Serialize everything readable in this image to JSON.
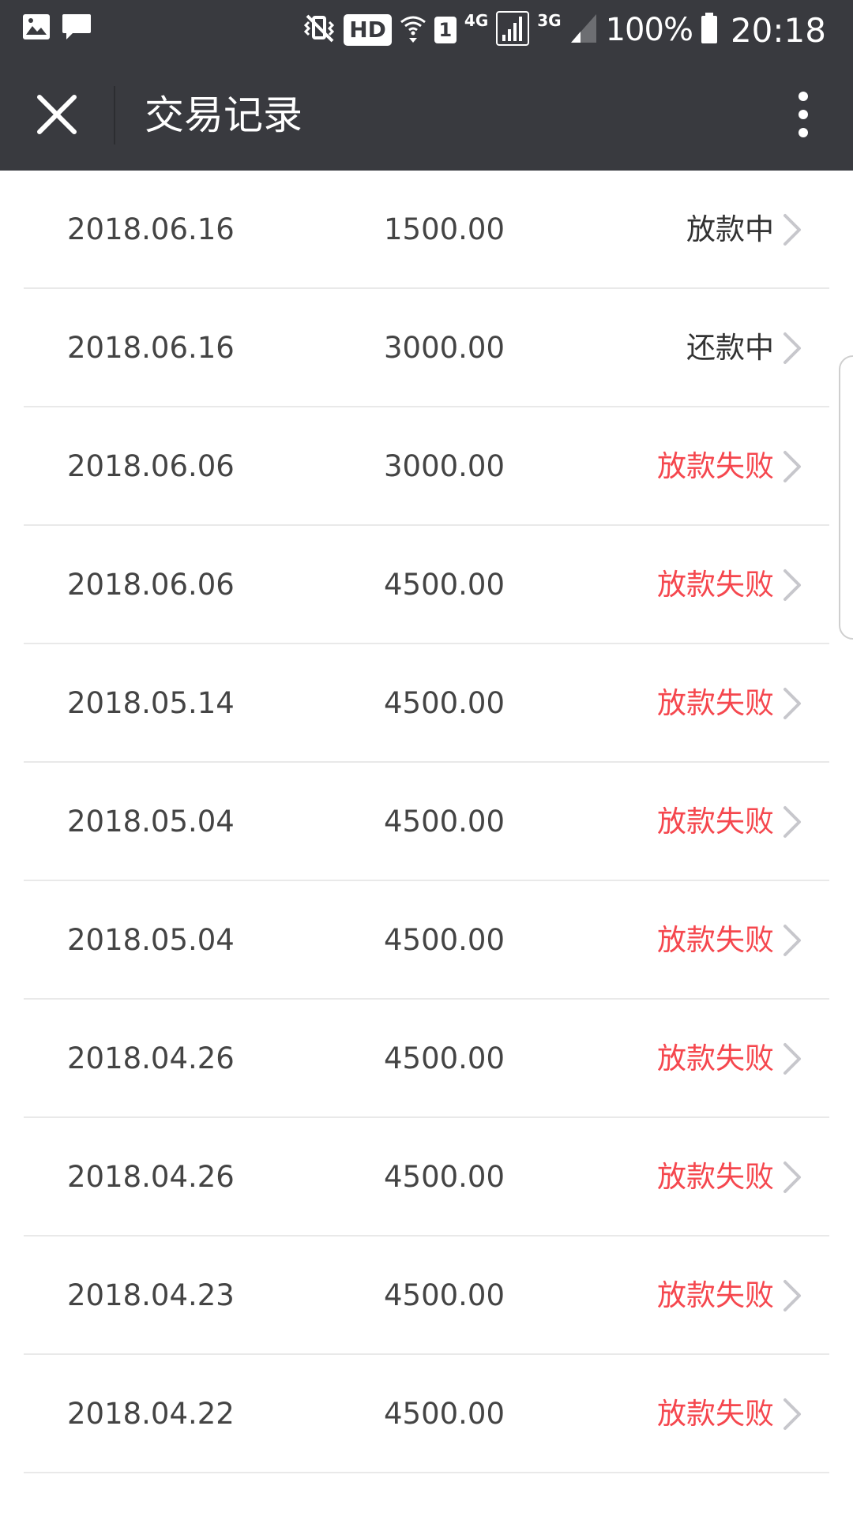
{
  "status_bar": {
    "left_icons": [
      "gallery-icon",
      "message-icon"
    ],
    "mute_icon": "mute-vibrate-icon",
    "hd_label": "HD",
    "wifi_icon": "wifi-icon",
    "sim_label": "1",
    "network_4g": "4G",
    "network_3g": "3G",
    "battery_percent": "100%",
    "time": "20:18"
  },
  "titlebar": {
    "title": "交易记录",
    "close_icon": "close-icon",
    "more_icon": "more-vertical-icon",
    "background": "#393a3f"
  },
  "colors": {
    "status_normal": "#333333",
    "status_failed": "#f5474e",
    "text": "#444444"
  },
  "transactions": [
    {
      "date": "2018.06.16",
      "amount": "1500.00",
      "status": "放款中",
      "state": "normal"
    },
    {
      "date": "2018.06.16",
      "amount": "3000.00",
      "status": "还款中",
      "state": "normal"
    },
    {
      "date": "2018.06.06",
      "amount": "3000.00",
      "status": "放款失败",
      "state": "failed"
    },
    {
      "date": "2018.06.06",
      "amount": "4500.00",
      "status": "放款失败",
      "state": "failed"
    },
    {
      "date": "2018.05.14",
      "amount": "4500.00",
      "status": "放款失败",
      "state": "failed"
    },
    {
      "date": "2018.05.04",
      "amount": "4500.00",
      "status": "放款失败",
      "state": "failed"
    },
    {
      "date": "2018.05.04",
      "amount": "4500.00",
      "status": "放款失败",
      "state": "failed"
    },
    {
      "date": "2018.04.26",
      "amount": "4500.00",
      "status": "放款失败",
      "state": "failed"
    },
    {
      "date": "2018.04.26",
      "amount": "4500.00",
      "status": "放款失败",
      "state": "failed"
    },
    {
      "date": "2018.04.23",
      "amount": "4500.00",
      "status": "放款失败",
      "state": "failed"
    },
    {
      "date": "2018.04.22",
      "amount": "4500.00",
      "status": "放款失败",
      "state": "failed"
    }
  ]
}
